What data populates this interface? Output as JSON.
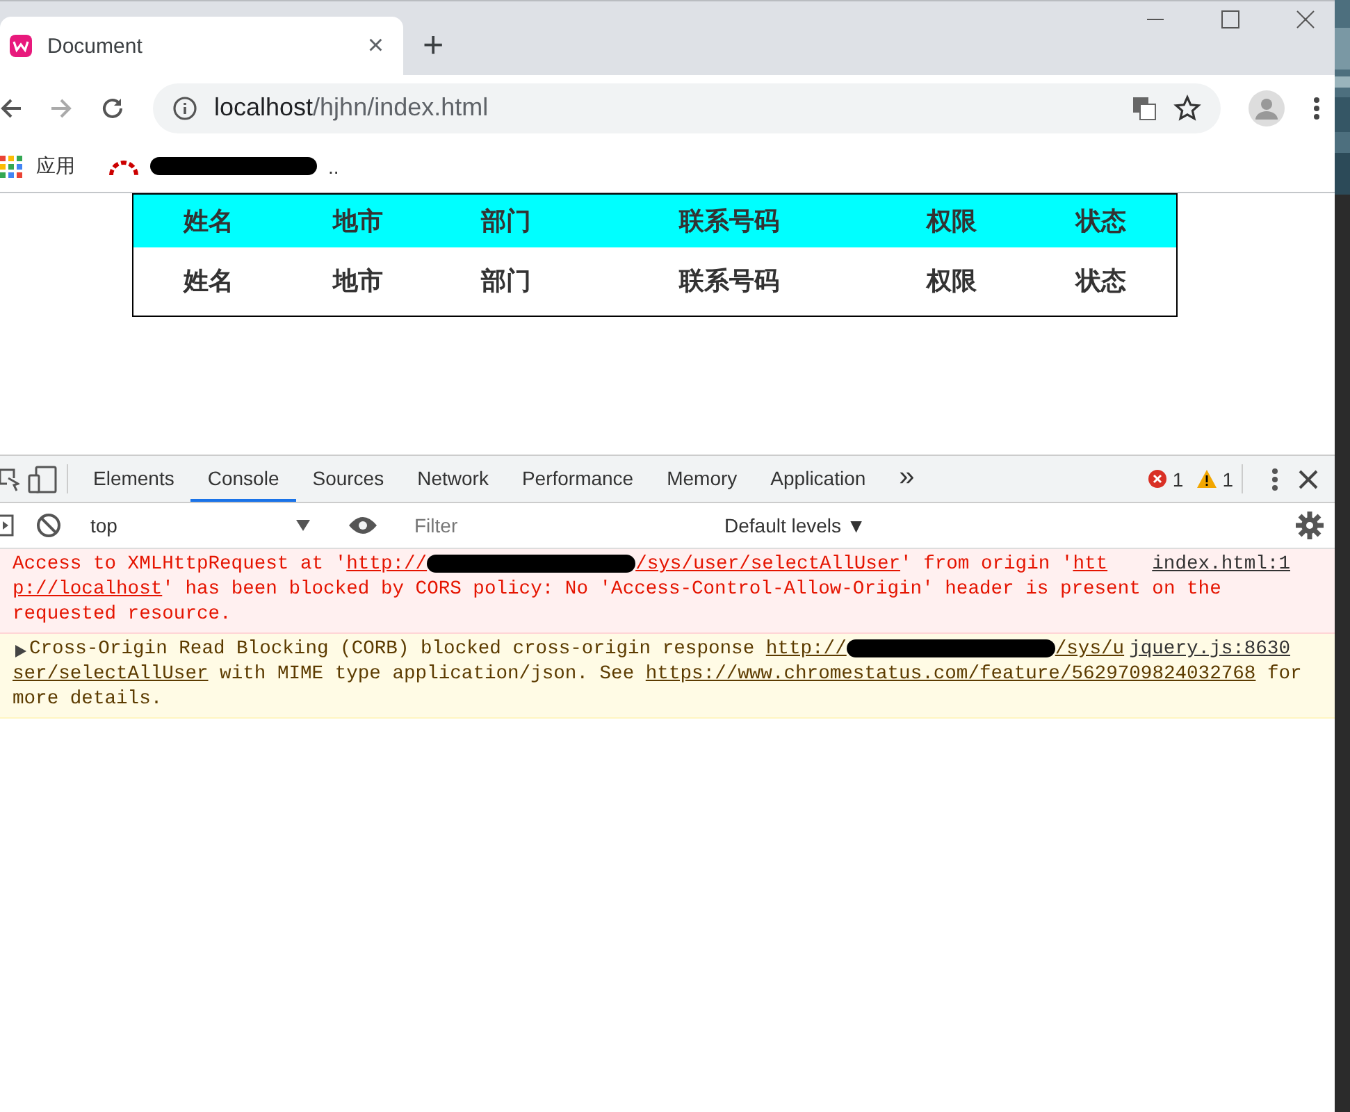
{
  "browser": {
    "tab": {
      "title": "Document",
      "close": "×"
    },
    "new_tab": "+",
    "address": {
      "host": "localhost",
      "path": "/hjhn/index.html"
    },
    "bookmarks": [
      {
        "kind": "apps",
        "label": "应用"
      },
      {
        "kind": "redacted",
        "label": ".."
      }
    ]
  },
  "table": {
    "header": [
      "姓名",
      "地市",
      "部门",
      "联系号码",
      "权限",
      "状态"
    ],
    "rows": [
      [
        "姓名",
        "地市",
        "部门",
        "联系号码",
        "权限",
        "状态"
      ]
    ]
  },
  "devtools": {
    "tabs": [
      {
        "label": "Elements",
        "selected": false
      },
      {
        "label": "Console",
        "selected": true
      },
      {
        "label": "Sources",
        "selected": false
      },
      {
        "label": "Network",
        "selected": false
      },
      {
        "label": "Performance",
        "selected": false
      },
      {
        "label": "Memory",
        "selected": false
      },
      {
        "label": "Application",
        "selected": false
      }
    ],
    "more": "»",
    "errors": "1",
    "warnings": "1",
    "context": "top",
    "filter_placeholder": "Filter",
    "levels": "Default levels ▼",
    "messages": [
      {
        "kind": "error",
        "source": "index.html:1",
        "lines": [
          [
            {
              "kind": "text",
              "text": "Access to XMLHttpRequest at '"
            },
            {
              "kind": "link",
              "text": "http://",
              "redacted": true,
              "after": "/sys/user/selectAllUser"
            },
            {
              "kind": "text",
              "text": "' from origin '"
            },
            {
              "kind": "link",
              "text": "htt"
            }
          ],
          [
            {
              "kind": "link",
              "text": "p://localhost"
            },
            {
              "kind": "text",
              "text": "' has been blocked by CORS policy: No 'Access-Control-Allow-Origin' header is present on the"
            }
          ],
          [
            {
              "kind": "text",
              "text": "requested resource."
            }
          ]
        ]
      },
      {
        "kind": "warning",
        "source": "jquery.js:8630",
        "lines": [
          [
            {
              "kind": "text",
              "text": "Cross-Origin Read Blocking (CORB) blocked cross-origin response "
            },
            {
              "kind": "link",
              "text": "http://",
              "redacted": true,
              "after": "/sys/u"
            }
          ],
          [
            {
              "kind": "link",
              "text": "ser/selectAllUser"
            },
            {
              "kind": "text",
              "text": " with MIME type application/json. See "
            },
            {
              "kind": "link",
              "text": "https://www.chromestatus.com/feature/5629709824032768"
            },
            {
              "kind": "text",
              "text": " for"
            }
          ],
          [
            {
              "kind": "text",
              "text": "more details."
            }
          ]
        ]
      }
    ]
  }
}
